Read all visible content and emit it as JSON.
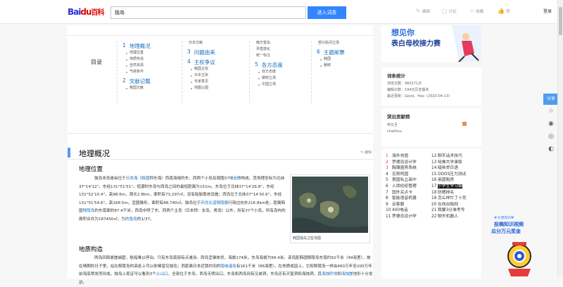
{
  "header": {
    "logo_bai": "Bai",
    "logo_du": "du",
    "logo_baike": "百科",
    "search_value": "独岛",
    "search_button": "进入词条",
    "tools": [
      {
        "icon": "edit-icon",
        "label": "编辑"
      },
      {
        "icon": "discuss-icon",
        "label": "讨论"
      },
      {
        "icon": "collect-icon",
        "label": "收藏"
      },
      {
        "icon": "like-icon",
        "label": "赞"
      }
    ],
    "login": "登录"
  },
  "catalog": {
    "title": "目录",
    "col1": [
      {
        "type": "h",
        "num": "1",
        "label": "地理概况"
      },
      {
        "type": "i",
        "label": "地理位置"
      },
      {
        "type": "i",
        "label": "地质构造"
      },
      {
        "type": "i",
        "label": "自然资源"
      },
      {
        "type": "i",
        "label": "气候条件"
      },
      {
        "type": "h",
        "num": "2",
        "label": "文献记载"
      },
      {
        "type": "i",
        "label": "韩国文献"
      }
    ],
    "col2": [
      {
        "type": "p",
        "label": "日本文献"
      },
      {
        "type": "h",
        "num": "3",
        "label": "问题由来"
      },
      {
        "type": "h",
        "num": "4",
        "label": "主权争议"
      },
      {
        "type": "i",
        "label": "韩国主张"
      },
      {
        "type": "i",
        "label": "日本主张"
      },
      {
        "type": "i",
        "label": "专家意见"
      },
      {
        "type": "i",
        "label": "地图公图"
      }
    ],
    "col3": [
      {
        "type": "p",
        "label": "韩方登岛"
      },
      {
        "type": "p",
        "label": "矛盾激化"
      },
      {
        "type": "p",
        "label": "统一标注"
      },
      {
        "type": "h",
        "num": "5",
        "label": "各方态度"
      },
      {
        "type": "i",
        "label": "双方态度"
      },
      {
        "type": "i",
        "label": "朝鲜立场"
      },
      {
        "type": "i",
        "label": "中国立场"
      }
    ],
    "col4": [
      {
        "type": "p",
        "label": "部分民间立场"
      },
      {
        "type": "h",
        "num": "6",
        "label": "主题邮票"
      },
      {
        "type": "i",
        "label": "韩国"
      },
      {
        "type": "i",
        "label": "朝鲜"
      }
    ]
  },
  "section": {
    "title": "地理概况",
    "edit": "编辑",
    "sub1": "地理位置",
    "sub2": "地质构造",
    "para1_segments": [
      {
        "t": "独岛本岛是由位于"
      },
      {
        "t": "日本海",
        "l": true
      },
      {
        "t": "（"
      },
      {
        "t": "韩国",
        "l": true
      },
      {
        "t": "称东海）西南海域的东、西两个小岛及周围37块"
      },
      {
        "t": "岩礁",
        "l": true
      },
      {
        "t": "构成。其地理坐标为北纬37°14'12\"，东经131°51'51\"。低潮时东岛与西岛之间的最短距离为151m。东岛位于北纬37°14'26.8\"，东经131°52'10.4\"，高98.6m，周长2.8km，面积有73,297㎡，设有船舶靠岸设施；西岛位于北纬37°14'30.6\"，东经131°51'54.6\"，高168.5m，呈圆锥形，面积有88,740㎡。独岛位于"
      },
      {
        "t": "庆尚北道郁陵郡",
        "l": true
      },
      {
        "t": "行政边向东216.8km处，距离韩国"
      },
      {
        "t": "郁陵岛",
        "l": true
      },
      {
        "t": "的东南面的87.4千米，西岛中除了东、西两个主岛（日本称：女岛、男岛）以外，尚有37个小岛，所有岛屿的面积合共为187450㎡，为"
      },
      {
        "t": "的鱼岛",
        "l": true
      },
      {
        "t": "的1/37。"
      }
    ],
    "para2_segments": [
      {
        "t": "两岛四周悬崖峭壁，航船难以停泊。只有东岛南部有点滩涂。西岛呈锥体状，海拔174米，东岛海拔为99.4米。该岛距韩国郁陵岛东南约92千米（49海里），故在晴朗的日子里，站在郁陵岛的高处上可以依稀望见独岛；而距离日本近我时间的"
      },
      {
        "t": "隐岐诸岛",
        "l": true
      },
      {
        "t": "有161千米（86海里）。在地质成因上，它和郁陵岛一样由460万年至200万年前海底喷发而形成，独岛上现证可以看到3个"
      },
      {
        "t": "火山口",
        "l": true
      },
      {
        "t": "，全部位于东岛，西岛无喷出口。东岛和西岛间有见弟洞，东岛还有天窗洞和海蚀洞，其"
      },
      {
        "t": "海蚀阶地",
        "l": true
      },
      {
        "t": "和"
      },
      {
        "t": "海蚀崖",
        "l": true
      },
      {
        "t": "地形十分发达。"
      }
    ],
    "figure_caption": "韩国独岛卫星地图"
  },
  "side": {
    "banner_line1": "想见你",
    "banner_line2": "表白母校接力赛",
    "stats_title": "词条统计",
    "stats": [
      "浏览次数：960171次",
      "编辑次数：194次历史版本",
      "最近更新：Good、Hao（2020-04-13）"
    ],
    "contrib_title": "突出贡献榜",
    "contrib_users": [
      "申又旦",
      "chailhsu"
    ],
    "hot_left": [
      {
        "n": "1",
        "t": "海外充值"
      },
      {
        "n": "2",
        "t": "罗德岛设计学"
      },
      {
        "n": "3",
        "t": "胸薄盛宾系统"
      },
      {
        "n": "4",
        "t": "瓦努阿国"
      },
      {
        "n": "5",
        "t": "美国私立高中"
      },
      {
        "n": "6",
        "t": "入境检疫管理"
      },
      {
        "n": "7",
        "t": "国外买点卡"
      },
      {
        "n": "8",
        "t": "智能语音机器"
      },
      {
        "n": "9",
        "t": "云客服"
      },
      {
        "n": "10",
        "t": "400电话"
      },
      {
        "n": "11",
        "t": "罗德岛设计学"
      }
    ],
    "hot_right": [
      {
        "n": "12",
        "t": "聊天话术技巧"
      },
      {
        "n": "13",
        "t": "哈佛大学录取"
      },
      {
        "n": "14",
        "t": "暗咏举日语"
      },
      {
        "n": "15",
        "t": "DDOS压力测试"
      },
      {
        "n": "16",
        "t": "英国租房"
      },
      {
        "n": "17",
        "t": "小学生学习编"
      },
      {
        "n": "18",
        "t": "防晒排名"
      },
      {
        "n": "19",
        "t": "怎么样忙了卜死"
      },
      {
        "n": "20",
        "t": "在线出租网"
      },
      {
        "n": "21",
        "t": "我要3分准考号"
      },
      {
        "n": "22",
        "t": "聊天机器人"
      }
    ]
  },
  "share": {
    "label": "分享"
  },
  "promo": {
    "tag": "#分享知识#",
    "line1": "投稿知识视频",
    "line2": "瓜分万元奖金"
  }
}
